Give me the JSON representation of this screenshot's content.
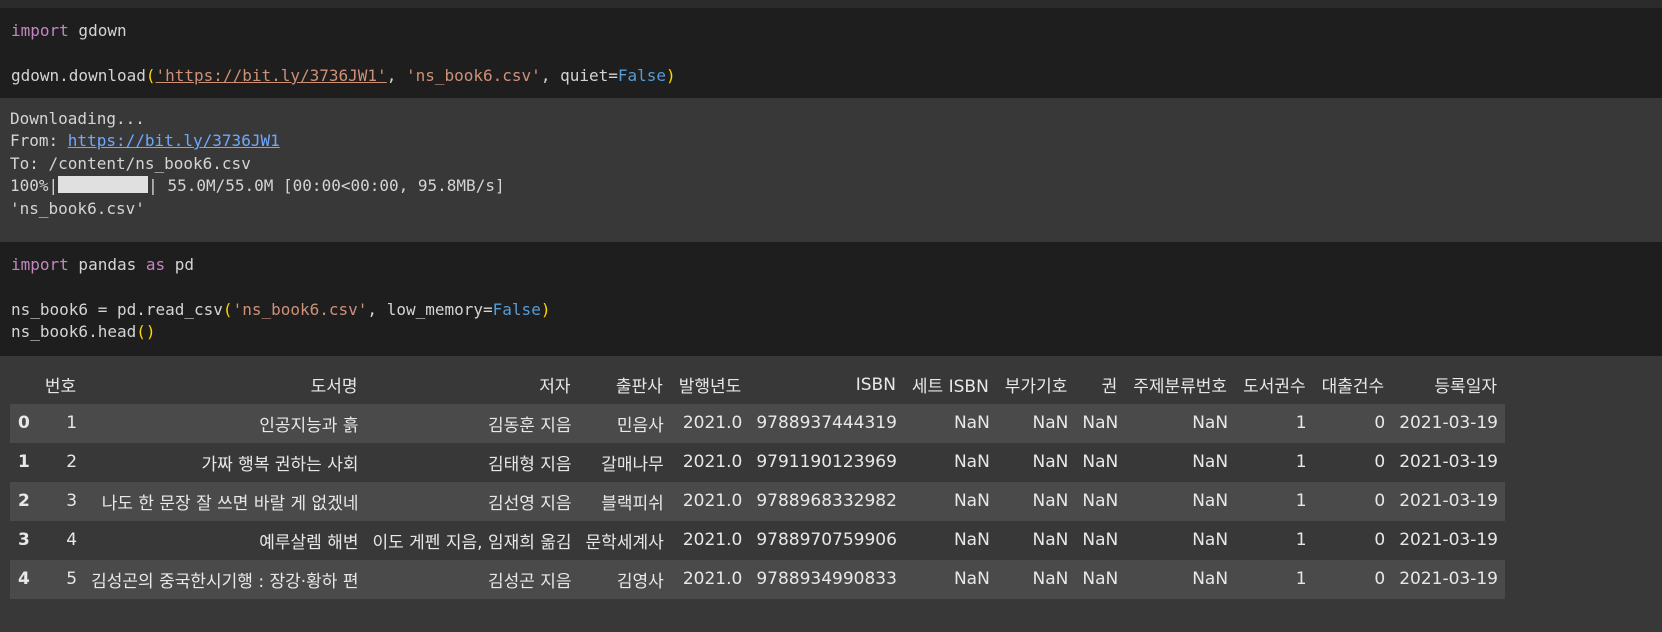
{
  "cell1": {
    "line1": {
      "kw": "import",
      "rest": " gdown"
    },
    "line2": {
      "fn": "gdown.download",
      "url": "'https://bit.ly/3736JW1'",
      "sep": ", ",
      "fname": "'ns_book6.csv'",
      "quiet": ", quiet=",
      "false": "False"
    }
  },
  "output1": {
    "downloading": "Downloading...",
    "from_label": "From: ",
    "from_url": "https://bit.ly/3736JW1",
    "to": "To: /content/ns_book6.csv",
    "progress_pct": "100%|",
    "progress_fraction": 1.0,
    "progress_rest": "| 55.0M/55.0M [00:00<00:00, 95.8MB/s]",
    "result": "'ns_book6.csv'"
  },
  "cell2": {
    "line1": {
      "kw": "import",
      "mid": " pandas ",
      "kw2": "as",
      "rest": " pd"
    },
    "line2": {
      "pre": "ns_book6 = pd.read_csv",
      "arg": "'ns_book6.csv'",
      "mid": ", low_memory=",
      "false": "False"
    },
    "line3": {
      "pre": "ns_book6.head"
    }
  },
  "table": {
    "columns": [
      "번호",
      "도서명",
      "저자",
      "출판사",
      "발행년도",
      "ISBN",
      "세트 ISBN",
      "부가기호",
      "권",
      "주제분류번호",
      "도서권수",
      "대출건수",
      "등록일자"
    ],
    "rows": [
      {
        "idx": "0",
        "cells": [
          "1",
          "인공지능과 흙",
          "김동훈 지음",
          "민음사",
          "2021.0",
          "9788937444319",
          "NaN",
          "NaN",
          "NaN",
          "NaN",
          "1",
          "0",
          "2021-03-19"
        ]
      },
      {
        "idx": "1",
        "cells": [
          "2",
          "가짜 행복 권하는 사회",
          "김태형 지음",
          "갈매나무",
          "2021.0",
          "9791190123969",
          "NaN",
          "NaN",
          "NaN",
          "NaN",
          "1",
          "0",
          "2021-03-19"
        ]
      },
      {
        "idx": "2",
        "cells": [
          "3",
          "나도 한 문장 잘 쓰면 바랄 게 없겠네",
          "김선영 지음",
          "블랙피쉬",
          "2021.0",
          "9788968332982",
          "NaN",
          "NaN",
          "NaN",
          "NaN",
          "1",
          "0",
          "2021-03-19"
        ]
      },
      {
        "idx": "3",
        "cells": [
          "4",
          "예루살렘 해변",
          "이도 게펜 지음, 임재희 옮김",
          "문학세계사",
          "2021.0",
          "9788970759906",
          "NaN",
          "NaN",
          "NaN",
          "NaN",
          "1",
          "0",
          "2021-03-19"
        ]
      },
      {
        "idx": "4",
        "cells": [
          "5",
          "김성곤의 중국한시기행 : 장강·황하 편",
          "김성곤 지음",
          "김영사",
          "2021.0",
          "9788934990833",
          "NaN",
          "NaN",
          "NaN",
          "NaN",
          "1",
          "0",
          "2021-03-19"
        ]
      }
    ]
  }
}
